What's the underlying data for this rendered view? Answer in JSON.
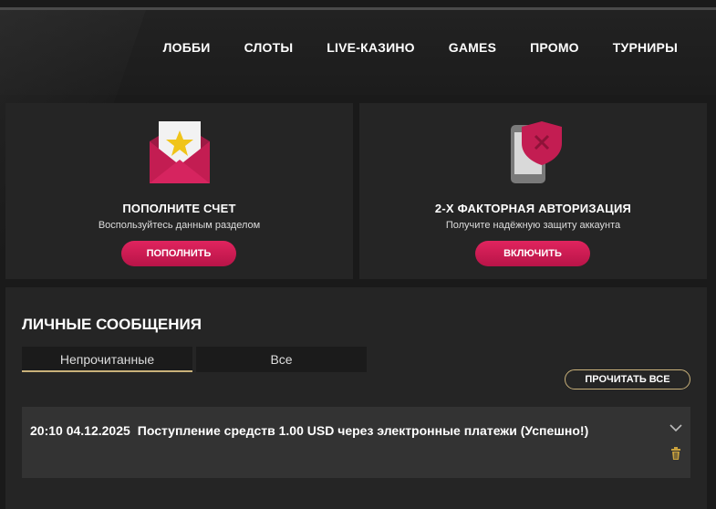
{
  "nav": {
    "items": [
      "ЛОББИ",
      "СЛОТЫ",
      "LIVE-КАЗИНО",
      "GAMES",
      "ПРОМО",
      "ТУРНИРЫ"
    ]
  },
  "cards": {
    "deposit": {
      "title": "ПОПОЛНИТЕ СЧЕТ",
      "subtitle": "Воспользуйтесь данным разделом",
      "button": "ПОПОЛНИТЬ",
      "icon": "envelope-star-icon"
    },
    "twofa": {
      "title": "2-Х ФАКТОРНАЯ АВТОРИЗАЦИЯ",
      "subtitle": "Получите надёжную защиту аккаунта",
      "button": "ВКЛЮЧИТЬ",
      "icon": "phone-shield-icon"
    }
  },
  "messages": {
    "title": "ЛИЧНЫЕ СООБЩЕНИЯ",
    "tabs": [
      "Непрочитанные",
      "Все"
    ],
    "active_tab": "Непрочитанные",
    "read_all": "ПРОЧИТАТЬ ВСЕ",
    "items": [
      {
        "time": "20:10 04.12.2025",
        "text": "Поступление средств 1.00 USD через электронные платежи (Успешно!)"
      }
    ]
  },
  "colors": {
    "accent": "#d81e5b",
    "gold": "#c9b17a",
    "background": "#1a1a1a",
    "card": "#252525"
  }
}
